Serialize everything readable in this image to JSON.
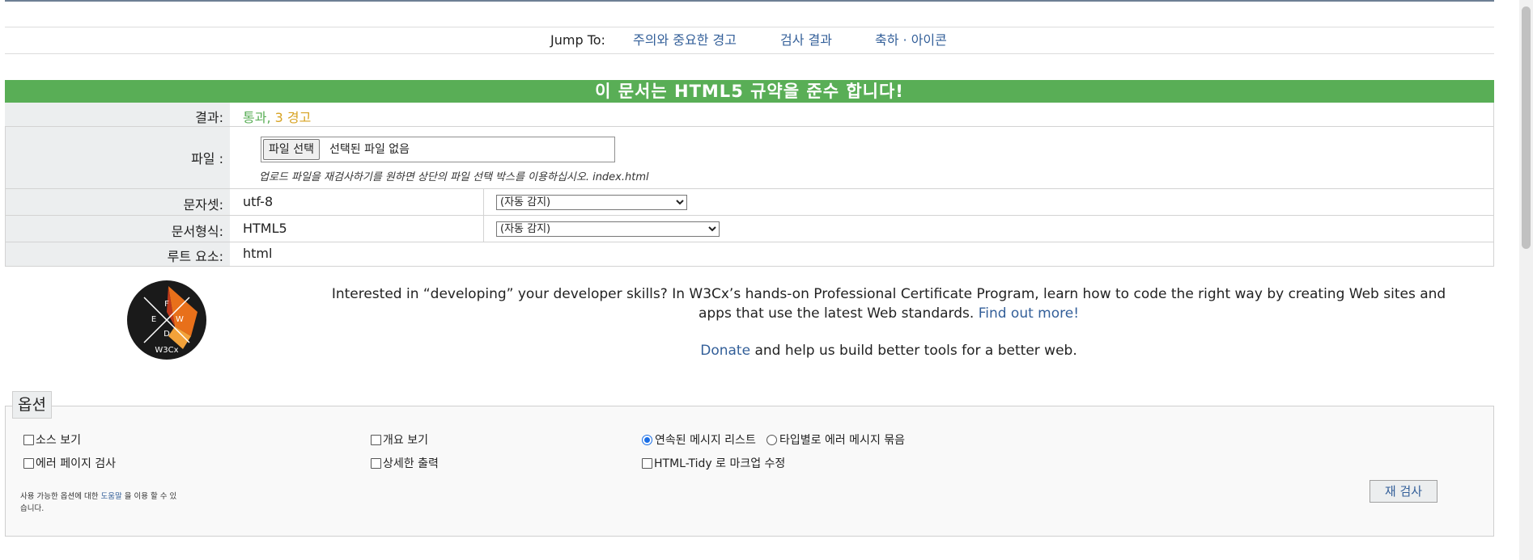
{
  "jump": {
    "label": "Jump To:",
    "links": [
      "주의와 중요한 경고",
      "검사 결과",
      "축하 · 아이콘"
    ]
  },
  "result_header": "이 문서는 HTML5 규약을 준수 합니다!",
  "rows": {
    "result_label": "결과:",
    "result_pass": "통과,",
    "result_warn": "3 경고",
    "file_label": "파일 :",
    "file_button": "파일 선택",
    "file_status": "선택된 파일 없음",
    "file_hint": "업로드 파일을 재검사하기를 원하면 상단의 파일 선택 박스를 이용하십시오. index.html",
    "charset_label": "문자셋:",
    "charset_value": "utf-8",
    "charset_select": "(자동 감지)",
    "doctype_label": "문서형식:",
    "doctype_value": "HTML5",
    "doctype_select": "(자동 감지)",
    "root_label": "루트 요소:",
    "root_value": "html"
  },
  "promo": {
    "text": "Interested in “developing” your developer skills? In W3Cx’s hands-on Professional Certificate Program, learn how to code the right way by creating Web sites and apps that use the latest Web standards.",
    "link": "Find out more!",
    "donate_link": "Donate",
    "donate_text": "and help us build better tools for a better web.",
    "logo_text": "W3Cx"
  },
  "options": {
    "legend": "옵션",
    "show_source": "소스 보기",
    "outline": "개요 보기",
    "sequential": "연속된 메시지 리스트",
    "group_by_type": "타입별로 에러 메시지 묶음",
    "error_pages": "에러 페이지 검사",
    "verbose": "상세한 출력",
    "tidy": "HTML-Tidy 로 마크업 수정",
    "note_prefix": "사용 가능한 옵션에 대한",
    "note_link": "도움말",
    "note_suffix": "을 이용 할 수 있습니다.",
    "recheck_button": "재 검사"
  },
  "colors": {
    "header_green": "#59ae56",
    "warn_amber": "#d7a323",
    "link_blue": "#335f99"
  }
}
